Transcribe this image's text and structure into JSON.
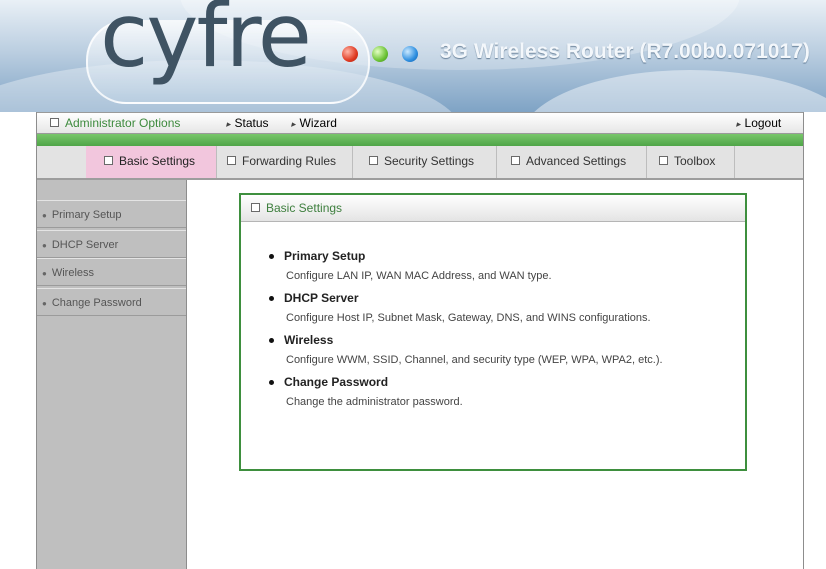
{
  "header": {
    "logo_text": "cyfre",
    "model_title": "3G Wireless Router (R7.00b0.071017)"
  },
  "topnav": {
    "admin": "Administrator Options",
    "status": "Status",
    "wizard": "Wizard",
    "logout": "Logout"
  },
  "tabs": [
    {
      "label": "Basic Settings"
    },
    {
      "label": "Forwarding Rules"
    },
    {
      "label": "Security Settings"
    },
    {
      "label": "Advanced Settings"
    },
    {
      "label": "Toolbox"
    }
  ],
  "sidebar": {
    "items": [
      {
        "label": "Primary Setup"
      },
      {
        "label": "DHCP Server"
      },
      {
        "label": "Wireless"
      },
      {
        "label": "Change Password"
      }
    ]
  },
  "panel": {
    "title": "Basic Settings",
    "entries": [
      {
        "title": "Primary Setup",
        "desc": "Configure LAN IP, WAN MAC Address, and WAN type."
      },
      {
        "title": "DHCP Server",
        "desc": "Configure Host IP, Subnet Mask, Gateway, DNS, and WINS configurations."
      },
      {
        "title": "Wireless",
        "desc": "Configure WWM, SSID, Channel, and security type (WEP, WPA, WPA2, etc.)."
      },
      {
        "title": "Change Password",
        "desc": "Change the administrator password."
      }
    ]
  },
  "colors": {
    "accent_green": "#3e8f3e",
    "active_tab": "#f2c6dd"
  }
}
